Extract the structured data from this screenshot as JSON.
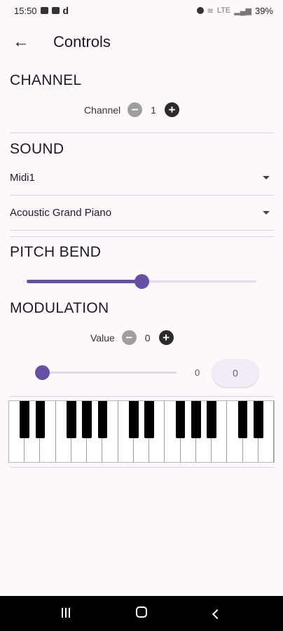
{
  "status_bar": {
    "time": "15:50",
    "app_letter": "d",
    "network": "LTE",
    "battery": "39%"
  },
  "app_bar": {
    "title": "Controls"
  },
  "channel": {
    "section_title": "CHANNEL",
    "label": "Channel",
    "value": "1"
  },
  "sound": {
    "section_title": "SOUND",
    "device": {
      "selected": "Midi1"
    },
    "instrument": {
      "selected": "Acoustic Grand Piano"
    }
  },
  "pitch_bend": {
    "section_title": "PITCH BEND",
    "position": 0.5
  },
  "modulation": {
    "section_title": "MODULATION",
    "label": "Value",
    "value": "0",
    "slider_position": 0.0,
    "slider_readout": "0",
    "chip_value": "0"
  },
  "keyboard": {
    "white_keys": 17,
    "black_keys": 12
  },
  "colors": {
    "accent": "#6750a4",
    "background": "#fcf8fc"
  }
}
